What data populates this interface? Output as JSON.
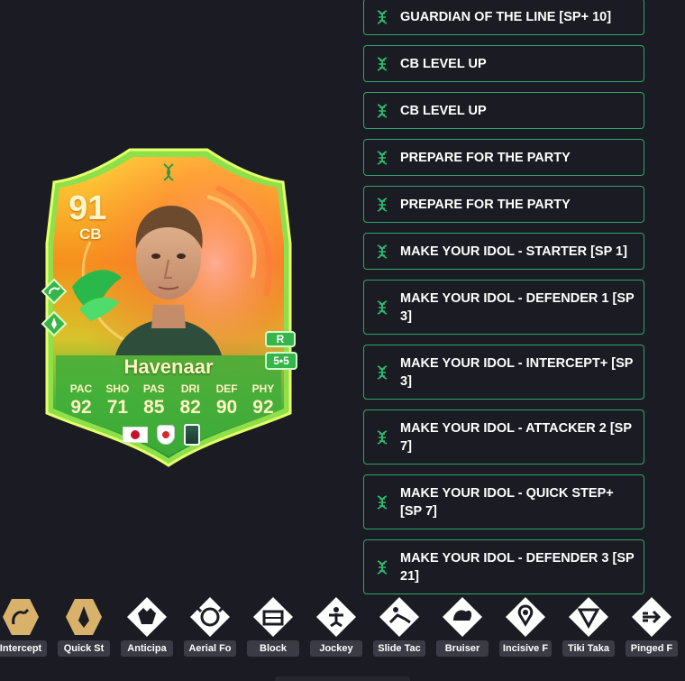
{
  "player": {
    "rating": "91",
    "position": "CB",
    "name": "Havenaar",
    "role_tag": "R",
    "skill_tag": "5•5",
    "stats": [
      {
        "label": "PAC",
        "value": "92"
      },
      {
        "label": "SHO",
        "value": "71"
      },
      {
        "label": "PAS",
        "value": "85"
      },
      {
        "label": "DRI",
        "value": "82"
      },
      {
        "label": "DEF",
        "value": "90"
      },
      {
        "label": "PHY",
        "value": "92"
      }
    ],
    "nation_icon": "japan-flag-icon",
    "league_icon": "austrian-league-badge-icon",
    "club_icon": "club-crest-icon"
  },
  "evolutions": [
    {
      "label": "GUARDIAN OF THE LINE [SP+ 10]"
    },
    {
      "label": "CB LEVEL UP"
    },
    {
      "label": "CB LEVEL UP"
    },
    {
      "label": "PREPARE FOR THE PARTY"
    },
    {
      "label": "PREPARE FOR THE PARTY"
    },
    {
      "label": "MAKE YOUR IDOL - STARTER [SP 1]"
    },
    {
      "label": "MAKE YOUR IDOL - DEFENDER 1 [SP 3]"
    },
    {
      "label": "MAKE YOUR IDOL - INTERCEPT+ [SP 3]"
    },
    {
      "label": "MAKE YOUR IDOL - ATTACKER 2 [SP 7]"
    },
    {
      "label": "MAKE YOUR IDOL - QUICK STEP+ [SP 7]"
    },
    {
      "label": "MAKE YOUR IDOL - DEFENDER 3 [SP 21]"
    }
  ],
  "playstyles": [
    {
      "label": "Intercept",
      "icon": "intercept-icon",
      "plus": true
    },
    {
      "label": "Quick St",
      "icon": "quick-step-icon",
      "plus": true
    },
    {
      "label": "Anticipa",
      "icon": "anticipate-icon",
      "plus": false
    },
    {
      "label": "Aerial Fo",
      "icon": "aerial-fortress-icon",
      "plus": false
    },
    {
      "label": "Block",
      "icon": "block-icon",
      "plus": false
    },
    {
      "label": "Jockey",
      "icon": "jockey-icon",
      "plus": false
    },
    {
      "label": "Slide Tac",
      "icon": "slide-tackle-icon",
      "plus": false
    },
    {
      "label": "Bruiser",
      "icon": "bruiser-icon",
      "plus": false
    },
    {
      "label": "Incisive F",
      "icon": "incisive-pass-icon",
      "plus": false
    },
    {
      "label": "Tiki Taka",
      "icon": "tiki-taka-icon",
      "plus": false
    },
    {
      "label": "Pinged F",
      "icon": "pinged-pass-icon",
      "plus": false
    }
  ],
  "colors": {
    "background": "#1b1c23",
    "evo_border": "#2fa56a",
    "playstyle_plus": "#d8b26a",
    "playstyle_base": "#ffffff",
    "card_green": "#35b54a",
    "card_orange": "#f59a1b"
  }
}
